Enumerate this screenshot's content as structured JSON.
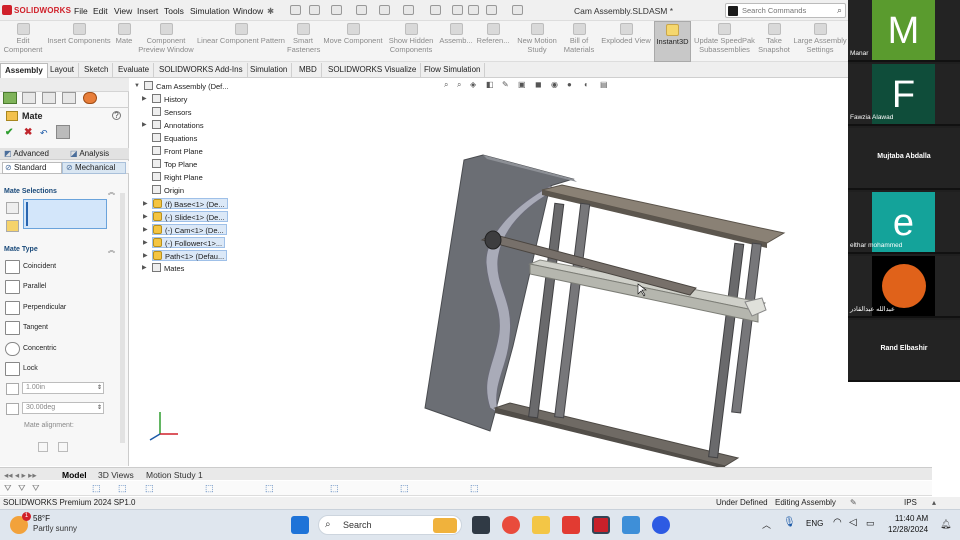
{
  "app": {
    "brand": "SOLIDWORKS",
    "document_title": "Cam Assembly.SLDASM *"
  },
  "menu": [
    "File",
    "Edit",
    "View",
    "Insert",
    "Tools",
    "Simulation",
    "Window"
  ],
  "search": {
    "placeholder": "Search Commands"
  },
  "command_manager": [
    "Edit\nComponent",
    "Insert Components",
    "Mate",
    "Component\nPreview Window",
    "Linear Component Pattern",
    "Smart\nFasteners",
    "Move Component",
    "Show Hidden\nComponents",
    "Assemb...",
    "Referen...",
    "New Motion\nStudy",
    "Bill of\nMaterials",
    "Exploded View",
    "Instant3D",
    "Update SpeedPak\nSubassemblies",
    "Take\nSnapshot",
    "Large Assembly\nSettings"
  ],
  "cm_tabs": [
    "Assembly",
    "Layout",
    "Sketch",
    "Evaluate",
    "SOLIDWORKS Add-Ins",
    "Simulation",
    "MBD",
    "SOLIDWORKS Visualize",
    "Flow Simulation"
  ],
  "property_manager": {
    "title": "Mate",
    "tabs": [
      "Advanced",
      "Analysis",
      "Standard",
      "Mechanical"
    ],
    "mate_selections_header": "Mate Selections",
    "mate_type_header": "Mate Type",
    "mate_types": [
      "Coincident",
      "Parallel",
      "Perpendicular",
      "Tangent",
      "Concentric",
      "Lock"
    ],
    "distance_value": "1.00in",
    "angle_value": "30.00deg",
    "mate_alignment_label": "Mate alignment:"
  },
  "feature_tree": [
    {
      "label": "Cam Assembly (Def...",
      "level": 0
    },
    {
      "label": "History",
      "level": 1
    },
    {
      "label": "Sensors",
      "level": 1
    },
    {
      "label": "Annotations",
      "level": 1
    },
    {
      "label": "Equations",
      "level": 1
    },
    {
      "label": "Front Plane",
      "level": 1
    },
    {
      "label": "Top Plane",
      "level": 1
    },
    {
      "label": "Right Plane",
      "level": 1
    },
    {
      "label": "Origin",
      "level": 1
    },
    {
      "label": "(f) Base<1> (De...",
      "level": 1
    },
    {
      "label": "(-) Slide<1> (De...",
      "level": 1
    },
    {
      "label": "(-) Cam<1> (De...",
      "level": 1
    },
    {
      "label": "(-) Follower<1>...",
      "level": 1
    },
    {
      "label": "Path<1> (Defau...",
      "level": 1
    },
    {
      "label": "Mates",
      "level": 1
    }
  ],
  "bottom_tabs": [
    "Model",
    "3D Views",
    "Motion Study 1"
  ],
  "status": {
    "version": "SOLIDWORKS Premium 2024 SP1.0",
    "definition": "Under Defined",
    "mode": "Editing Assembly",
    "units": "IPS"
  },
  "taskbar": {
    "weather_temp": "58°F",
    "weather_desc": "Partly sunny",
    "weather_badge": "1",
    "search_label": "Search",
    "language": "ENG",
    "time": "11:40 AM",
    "date": "12/28/2024"
  },
  "participants": [
    {
      "initial": "M",
      "name": "Manar",
      "color": "#5a9b2e"
    },
    {
      "initial": "F",
      "name": "Fawzia Alawad",
      "color": "#0f4d3a"
    },
    {
      "initial": "",
      "name": "Mujtaba Abdalla",
      "color": ""
    },
    {
      "initial": "e",
      "name": "elthar mohammed",
      "color": "#14a39a"
    },
    {
      "initial": "",
      "name": "عبدالله عبدالقادر",
      "color": "#e0621a"
    },
    {
      "initial": "",
      "name": "Rand Elbashir",
      "color": ""
    }
  ]
}
